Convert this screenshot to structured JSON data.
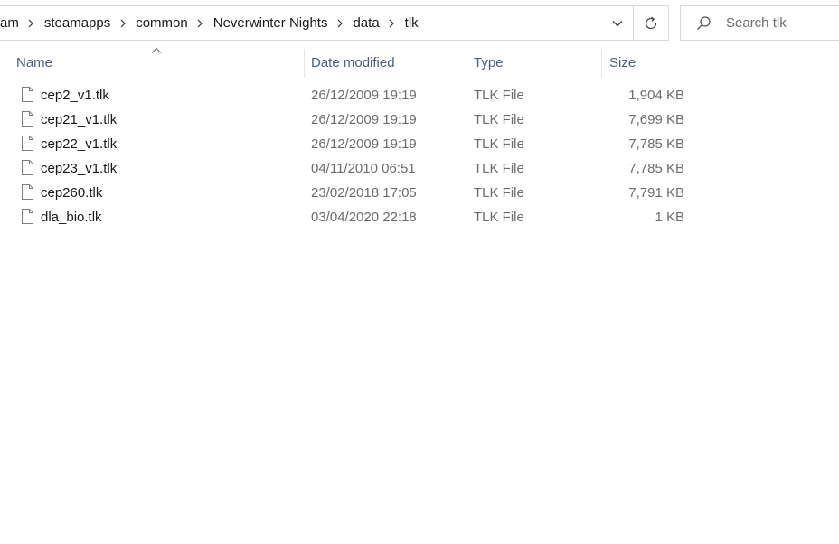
{
  "breadcrumb": [
    "am",
    "steamapps",
    "common",
    "Neverwinter Nights",
    "data",
    "tlk"
  ],
  "search": {
    "placeholder": "Search tlk",
    "value": ""
  },
  "columns": {
    "name": "Name",
    "date": "Date modified",
    "type": "Type",
    "size": "Size",
    "sorted_by": "name"
  },
  "files": [
    {
      "name": "cep2_v1.tlk",
      "date": "26/12/2009 19:19",
      "type": "TLK File",
      "size": "1,904 KB"
    },
    {
      "name": "cep21_v1.tlk",
      "date": "26/12/2009 19:19",
      "type": "TLK File",
      "size": "7,699 KB"
    },
    {
      "name": "cep22_v1.tlk",
      "date": "26/12/2009 19:19",
      "type": "TLK File",
      "size": "7,785 KB"
    },
    {
      "name": "cep23_v1.tlk",
      "date": "04/11/2010 06:51",
      "type": "TLK File",
      "size": "7,785 KB"
    },
    {
      "name": "cep260.tlk",
      "date": "23/02/2018 17:05",
      "type": "TLK File",
      "size": "7,791 KB"
    },
    {
      "name": "dla_bio.tlk",
      "date": "03/04/2020 22:18",
      "type": "TLK File",
      "size": "1 KB"
    }
  ],
  "icons": {
    "breadcrumb_separator": "chevron-right-icon",
    "address_dropdown": "chevron-down-icon",
    "refresh": "refresh-icon",
    "search": "search-icon",
    "file": "file-icon",
    "sort": "sort-up-icon"
  }
}
